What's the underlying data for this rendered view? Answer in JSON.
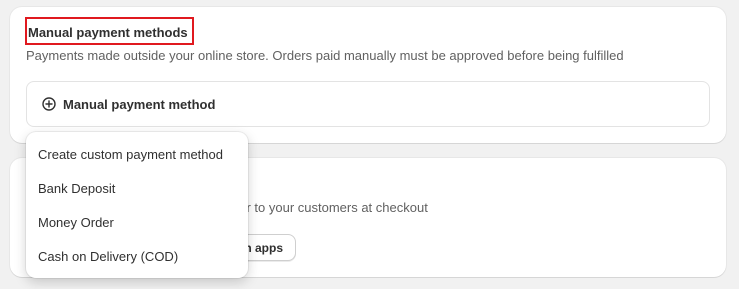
{
  "manual_payment": {
    "title": "Manual payment methods",
    "subtitle": "Payments made outside your online store. Orders paid manually must be approved before being fulfilled",
    "add_button_label": "Manual payment method",
    "add_button_icon": "plus-circle-icon"
  },
  "dropdown": {
    "items": [
      {
        "label": "Create custom payment method"
      },
      {
        "label": "Bank Deposit"
      },
      {
        "label": "Money Order"
      },
      {
        "label": "Cash on Delivery (COD)"
      }
    ]
  },
  "second_card": {
    "visible_text": "ear to your customers at checkout",
    "button_label": "n apps"
  },
  "colors": {
    "highlight_border": "#e0191f",
    "background": "#f1f1f1",
    "card": "#ffffff"
  }
}
